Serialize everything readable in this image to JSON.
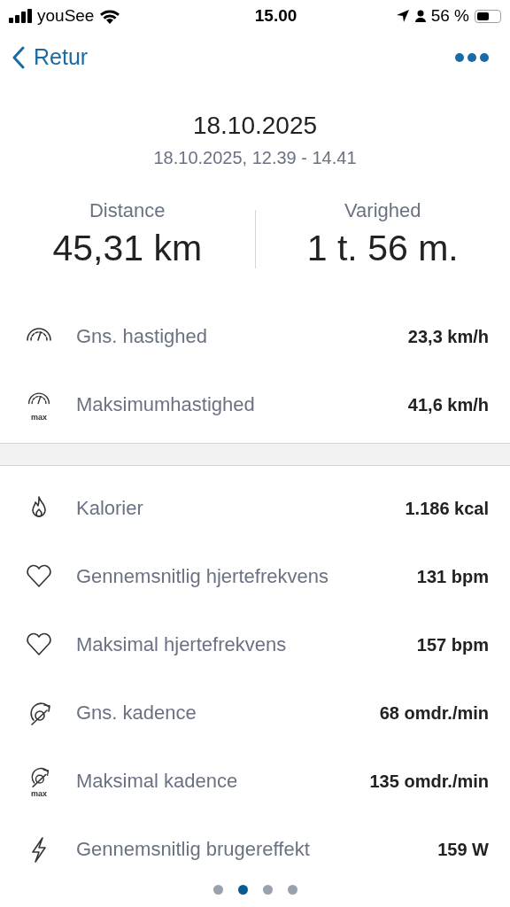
{
  "status_bar": {
    "carrier": "youSee",
    "time": "15.00",
    "battery_percent": "56 %"
  },
  "nav": {
    "back_label": "Retur"
  },
  "header": {
    "title": "18.10.2025",
    "subtitle": "18.10.2025, 12.39 - 14.41"
  },
  "summary": [
    {
      "label": "Distance",
      "value": "45,31 km"
    },
    {
      "label": "Varighed",
      "value": "1 t. 56 m."
    }
  ],
  "sections": [
    [
      {
        "kind": "speed",
        "label": "Gns. hastighed",
        "value": "23,3 km/h"
      },
      {
        "kind": "speed",
        "badge": "max",
        "label": "Maksimumhastighed",
        "value": "41,6 km/h"
      }
    ],
    [
      {
        "kind": "flame",
        "label": "Kalorier",
        "value": "1.186 kcal"
      },
      {
        "kind": "heart",
        "label": "Gennemsnitlig hjertefrekvens",
        "value": "131 bpm"
      },
      {
        "kind": "heart",
        "label": "Maksimal hjertefrekvens",
        "value": "157 bpm"
      },
      {
        "kind": "cadence",
        "label": "Gns. kadence",
        "value": "68 omdr./min"
      },
      {
        "kind": "cadence",
        "badge": "max",
        "label": "Maksimal kadence",
        "value": "135 omdr./min"
      },
      {
        "kind": "bolt",
        "label": "Gennemsnitlig brugereffekt",
        "value": "159 W"
      }
    ]
  ],
  "pages": [
    {
      "selected": false
    },
    {
      "selected": true
    },
    {
      "selected": false
    },
    {
      "selected": false
    }
  ]
}
